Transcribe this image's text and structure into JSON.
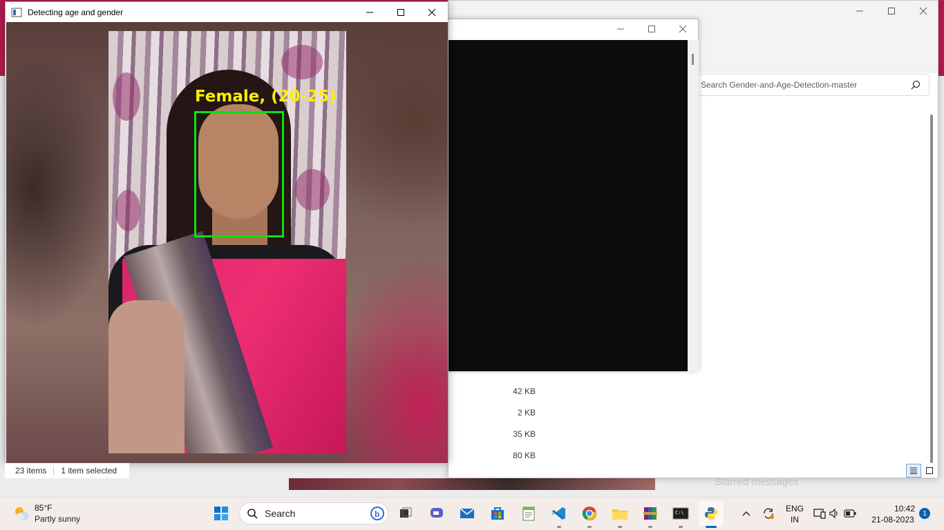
{
  "detect_window": {
    "title": "Detecting age and gender",
    "label": "Female, (20-25)"
  },
  "explorer": {
    "search_placeholder": "Search Gender-and-Age-Detection-master",
    "sizes": [
      "42 KB",
      "2 KB",
      "35 KB",
      "80 KB"
    ],
    "status_items": "23 items",
    "status_selected": "1 item selected"
  },
  "background": {
    "ghost_text": "Starred messages"
  },
  "taskbar": {
    "weather_temp": "85°F",
    "weather_desc": "Partly sunny",
    "search_label": "Search",
    "lang_top": "ENG",
    "lang_bottom": "IN",
    "time": "10:42",
    "date": "21-08-2023",
    "notifications": "1"
  },
  "colors": {
    "box": "#0ee10e",
    "label": "#ffee00",
    "accent": "#0063b1"
  }
}
